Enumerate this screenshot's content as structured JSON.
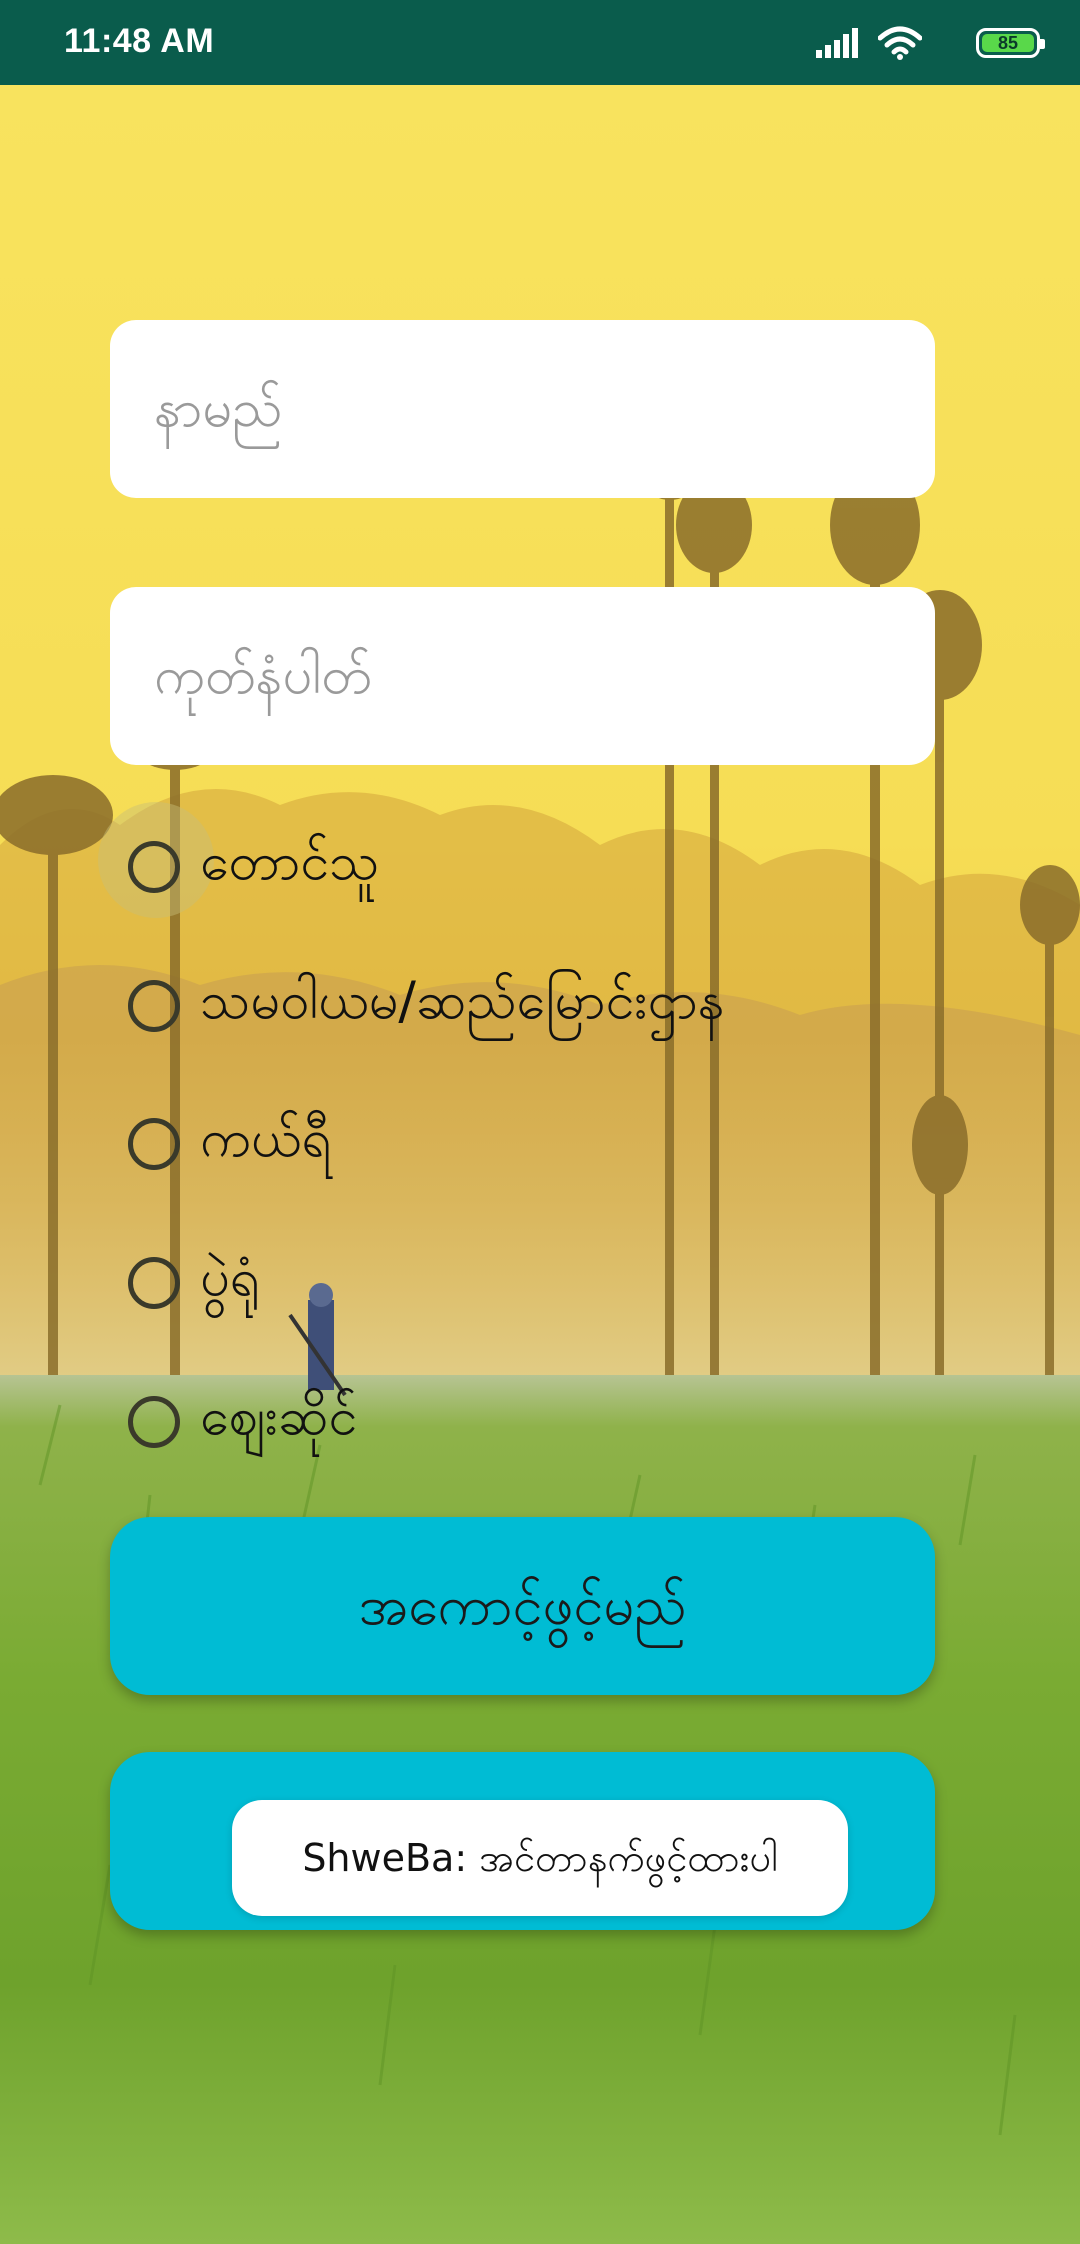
{
  "status_bar": {
    "time": "11:48 AM",
    "battery_level": "85"
  },
  "form": {
    "name_placeholder": "နာမည်",
    "nrc_placeholder": "ကုတ်နံပါတ်",
    "role_options": [
      {
        "label": "တောင်သူ",
        "selected": false
      },
      {
        "label": "သမဝါယမ/ဆည်မြောင်းဌာန",
        "selected": false
      },
      {
        "label": "ကယ်ရီ",
        "selected": false
      },
      {
        "label": "ပွဲရုံ",
        "selected": false
      },
      {
        "label": "ဈေးဆိုင်"
      }
    ],
    "open_account_label": "အကောင့်ဖွင့်မည်"
  },
  "toast": {
    "message": "ShweBa: အင်တာနက်ဖွင့်ထားပါ"
  },
  "colors": {
    "status_bar": "#0a5c4c",
    "button": "#00bcd4",
    "sky": "#f6df5a",
    "field": "#6aa32e"
  }
}
